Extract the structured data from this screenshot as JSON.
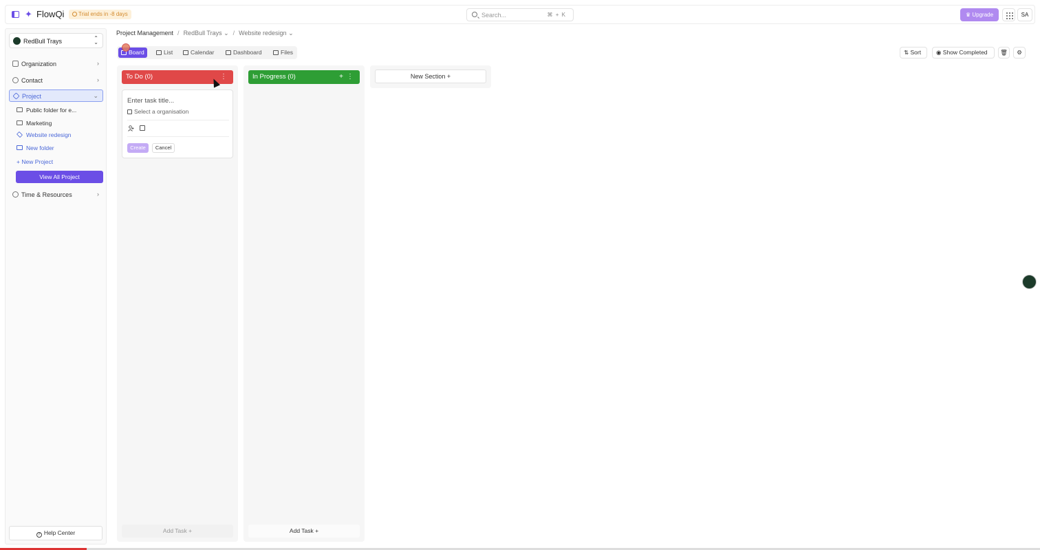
{
  "topbar": {
    "brand": "FlowQi",
    "trial": "Trial ends in -8 days",
    "search_placeholder": "Search...",
    "search_shortcut": "⌘ + K",
    "upgrade": "Upgrade",
    "avatar": "SA"
  },
  "sidebar": {
    "workspace": "RedBull Trays",
    "items": [
      {
        "label": "Organization"
      },
      {
        "label": "Contact"
      },
      {
        "label": "Project"
      },
      {
        "label": "Time & Resources"
      }
    ],
    "project_children": [
      {
        "label": "Public folder for e..."
      },
      {
        "label": "Marketing"
      },
      {
        "label": "Website redesign"
      },
      {
        "label": "New folder"
      }
    ],
    "new_project": "+ New Project",
    "view_all": "View All Project",
    "help": "Help Center"
  },
  "breadcrumb": {
    "root": "Project Management",
    "workspace": "RedBull Trays",
    "project": "Website redesign"
  },
  "views": {
    "tabs": [
      "Board",
      "List",
      "Calendar",
      "Dashboard",
      "Files"
    ],
    "active": "Board"
  },
  "toolbar": {
    "sort": "Sort",
    "show_completed": "Show Completed"
  },
  "board": {
    "columns": [
      {
        "title": "To Do (0)",
        "color": "#e04848",
        "add_task": "Add Task +"
      },
      {
        "title": "In Progress (0)",
        "color": "#2e9e35",
        "add_task": "Add Task +"
      }
    ],
    "new_section": "New Section +",
    "task_form": {
      "title_placeholder": "Enter task title...",
      "org_placeholder": "Select a organisation",
      "create": "Create",
      "cancel": "Cancel"
    }
  },
  "colors": {
    "accent": "#6b4ee6",
    "todo": "#e04848",
    "in_progress": "#2e9e35"
  }
}
